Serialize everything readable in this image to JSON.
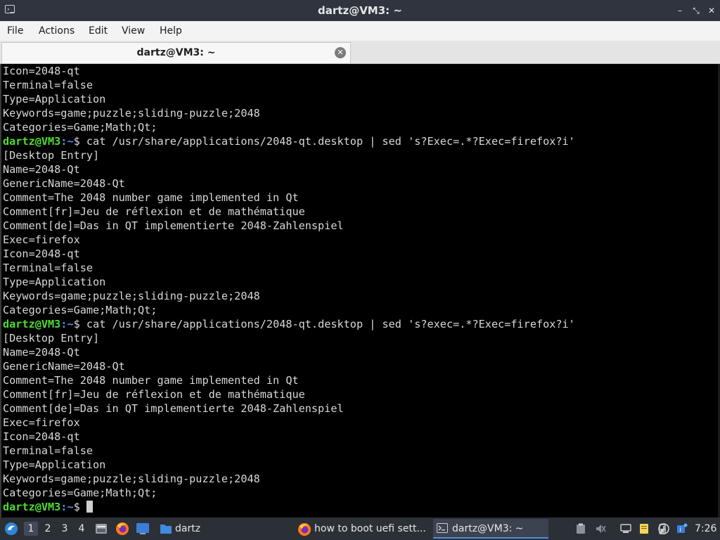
{
  "window": {
    "title": "dartz@VM3: ~",
    "app_icon_glyph": "›_",
    "controls": {
      "minimize": "–",
      "maximize": "⤡",
      "close": "✕"
    }
  },
  "menubar": {
    "file": "File",
    "actions": "Actions",
    "edit": "Edit",
    "view": "View",
    "help": "Help"
  },
  "tab": {
    "label": "dartz@VM3: ~",
    "close_glyph": "✕"
  },
  "terminal": {
    "prompt": {
      "user": "dartz@VM3",
      "path": "~",
      "symbol": "$ "
    },
    "colors": {
      "user": "#4ede31",
      "path": "#5b8ff2",
      "text": "#d8d8d8",
      "background": "#000000"
    },
    "lines": [
      {
        "text": "Icon=2048-qt"
      },
      {
        "text": "Terminal=false"
      },
      {
        "text": "Type=Application"
      },
      {
        "text": "Keywords=game;puzzle;sliding-puzzle;2048"
      },
      {
        "text": "Categories=Game;Math;Qt;"
      },
      {
        "prompt": true,
        "text": "cat /usr/share/applications/2048-qt.desktop | sed 's?Exec=.*?Exec=firefox?i'"
      },
      {
        "text": "[Desktop Entry]"
      },
      {
        "text": "Name=2048-Qt"
      },
      {
        "text": "GenericName=2048-Qt"
      },
      {
        "text": "Comment=The 2048 number game implemented in Qt"
      },
      {
        "text": "Comment[fr]=Jeu de réflexion et de mathématique"
      },
      {
        "text": "Comment[de]=Das in QT implementierte 2048-Zahlenspiel"
      },
      {
        "text": "Exec=firefox"
      },
      {
        "text": "Icon=2048-qt"
      },
      {
        "text": "Terminal=false"
      },
      {
        "text": "Type=Application"
      },
      {
        "text": "Keywords=game;puzzle;sliding-puzzle;2048"
      },
      {
        "text": "Categories=Game;Math;Qt;"
      },
      {
        "prompt": true,
        "text": "cat /usr/share/applications/2048-qt.desktop | sed 's?exec=.*?Exec=firefox?i'"
      },
      {
        "text": "[Desktop Entry]"
      },
      {
        "text": "Name=2048-Qt"
      },
      {
        "text": "GenericName=2048-Qt"
      },
      {
        "text": "Comment=The 2048 number game implemented in Qt"
      },
      {
        "text": "Comment[fr]=Jeu de réflexion et de mathématique"
      },
      {
        "text": "Comment[de]=Das in QT implementierte 2048-Zahlenspiel"
      },
      {
        "text": "Exec=firefox"
      },
      {
        "text": "Icon=2048-qt"
      },
      {
        "text": "Terminal=false"
      },
      {
        "text": "Type=Application"
      },
      {
        "text": "Keywords=game;puzzle;sliding-puzzle;2048"
      },
      {
        "text": "Categories=Game;Math;Qt;"
      },
      {
        "prompt": true,
        "text": "",
        "cursor": true
      }
    ]
  },
  "taskbar": {
    "workspaces": [
      "1",
      "2",
      "3",
      "4"
    ],
    "active_workspace": "1",
    "launchers": [
      "start-menu-icon",
      "file-manager-icon",
      "firefox-icon",
      "show-desktop-icon"
    ],
    "folder_task": "dartz",
    "tasks": [
      {
        "label": "how to boot uefi sett...",
        "icon": "firefox-icon"
      },
      {
        "label": "dartz@VM3: ~",
        "icon": "terminal-icon",
        "active": true
      }
    ],
    "tray_icons": [
      "clipboard-icon",
      "volume-muted-icon",
      "network-icon",
      "notes-icon",
      "battery-icon",
      "update-icon",
      "info-icon"
    ],
    "clock": "7:26"
  }
}
